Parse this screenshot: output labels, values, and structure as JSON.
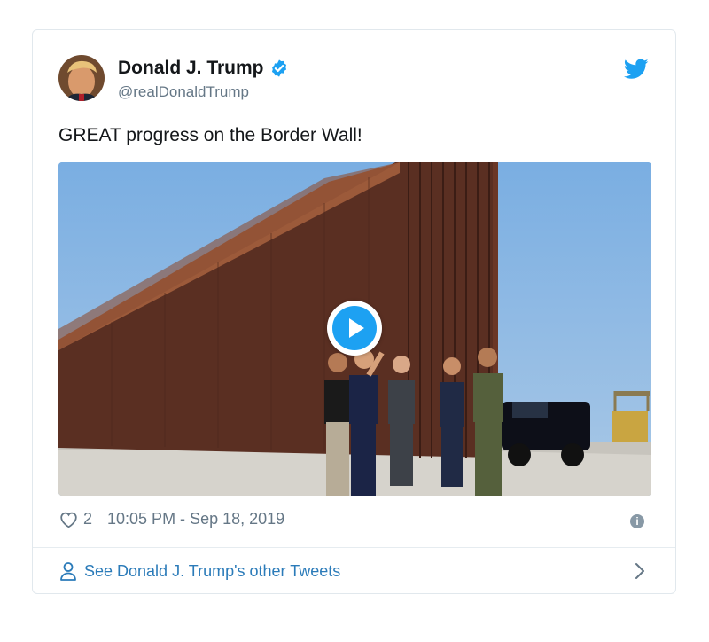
{
  "author": {
    "name": "Donald J. Trump",
    "handle": "@realDonaldTrump",
    "verified": true
  },
  "tweet": {
    "text": "GREAT progress on the Border Wall!"
  },
  "meta": {
    "like_count": "2",
    "timestamp": "10:05 PM - Sep 18, 2019"
  },
  "footer": {
    "link_label": "See Donald J. Trump's other Tweets"
  },
  "icons": {
    "verified": "verified-badge-icon",
    "twitter": "twitter-bird-icon",
    "like": "heart-icon",
    "info": "info-icon",
    "person": "person-icon",
    "chevron": "chevron-right-icon",
    "play": "play-icon"
  },
  "colors": {
    "brand_blue": "#1da1f2",
    "link_blue": "#2b7bb9",
    "text_primary": "#14171a",
    "text_secondary": "#657786",
    "border": "#e1e8ed"
  }
}
